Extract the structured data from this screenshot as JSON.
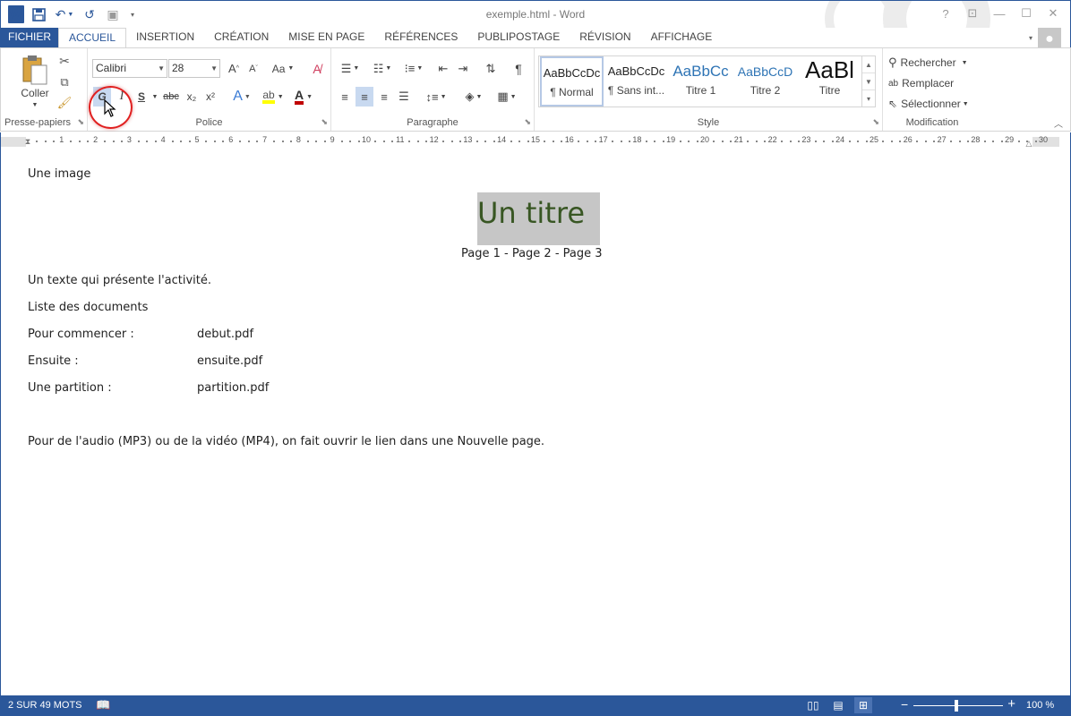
{
  "window": {
    "title": "exemple.html - Word",
    "help_label": "?"
  },
  "tabs": [
    {
      "label": "FICHIER"
    },
    {
      "label": "ACCUEIL"
    },
    {
      "label": "INSERTION"
    },
    {
      "label": "CRÉATION"
    },
    {
      "label": "MISE EN PAGE"
    },
    {
      "label": "RÉFÉRENCES"
    },
    {
      "label": "PUBLIPOSTAGE"
    },
    {
      "label": "RÉVISION"
    },
    {
      "label": "AFFICHAGE"
    }
  ],
  "ribbon": {
    "clipboard": {
      "paste_label": "Coller",
      "group_label": "Presse-papiers"
    },
    "font": {
      "font_name": "Calibri",
      "font_size": "28",
      "case_label": "Aa",
      "bold_label": "G",
      "italic_label": "I",
      "underline_label": "S",
      "strike_label": "abc",
      "sub_label": "x₂",
      "sup_label": "x²",
      "group_label": "Police",
      "highlight_color": "#ffff00",
      "font_color": "#c00000"
    },
    "paragraph": {
      "group_label": "Paragraphe"
    },
    "styles": {
      "group_label": "Style",
      "items": [
        {
          "sample": "AaBbCcDc",
          "name": "¶ Normal"
        },
        {
          "sample": "AaBbCcDc",
          "name": "¶ Sans int..."
        },
        {
          "sample": "AaBbCc",
          "name": "Titre 1"
        },
        {
          "sample": "AaBbCcD",
          "name": "Titre 2"
        },
        {
          "sample": "AaBl",
          "name": "Titre"
        }
      ]
    },
    "editing": {
      "group_label": "Modification",
      "find_label": "Rechercher",
      "replace_label": "Remplacer",
      "select_label": "Sélectionner"
    }
  },
  "ruler": {
    "numbers": [
      "1",
      "2",
      "3",
      "4",
      "5",
      "6",
      "7",
      "8",
      "9",
      "10",
      "11",
      "12",
      "13",
      "14",
      "15",
      "16",
      "17",
      "18",
      "19",
      "20",
      "21",
      "22",
      "23",
      "24",
      "25",
      "26",
      "27",
      "28",
      "29",
      "30"
    ]
  },
  "document": {
    "image_line": "Une image",
    "heading": "Un titre",
    "pages_line": "Page 1  -  Page 2 -  Page 3",
    "intro": "Un texte qui présente l'activité.",
    "list_title": "Liste des documents",
    "rows": [
      {
        "label": "Pour commencer :",
        "file": "debut.pdf"
      },
      {
        "label": "Ensuite :",
        "file": "ensuite.pdf"
      },
      {
        "label": "Une partition :",
        "file": "partition.pdf"
      }
    ],
    "footer_note": "Pour de l'audio (MP3) ou de la vidéo (MP4), on fait ouvrir le lien dans une Nouvelle page."
  },
  "status": {
    "word_count": "2 SUR 49 MOTS",
    "zoom_pct": "100 %"
  }
}
